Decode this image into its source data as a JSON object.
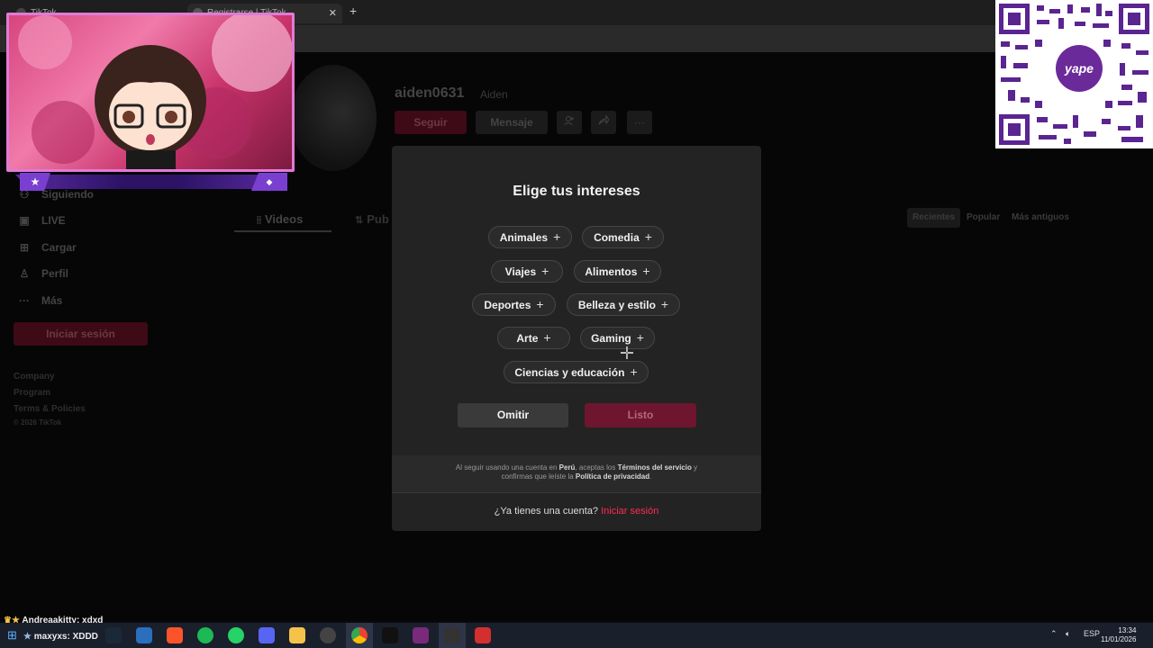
{
  "browser": {
    "tabs": [
      {
        "label": "TikTok"
      },
      {
        "label": "Registrarse | TikTok"
      }
    ],
    "new_tab": "+",
    "tab_close": "✕"
  },
  "profile": {
    "username": "aiden0631",
    "display_name": "Aiden",
    "follow_label": "Seguir",
    "message_label": "Mensaje",
    "more_label": "···"
  },
  "sidebar": {
    "items": [
      {
        "label": "Siguiendo",
        "icon": "following-icon"
      },
      {
        "label": "LIVE",
        "icon": "live-icon"
      },
      {
        "label": "Cargar",
        "icon": "upload-icon"
      },
      {
        "label": "Perfil",
        "icon": "profile-icon"
      },
      {
        "label": "Más",
        "icon": "more-icon"
      }
    ],
    "login_label": "Iniciar sesión",
    "footer": [
      "Company",
      "Program",
      "Terms & Policies",
      "© 2026 TikTok"
    ]
  },
  "content_tabs": {
    "videos": "Videos",
    "reposts": "Pub"
  },
  "sort": [
    "Recientes",
    "Popular",
    "Más antiguos"
  ],
  "modal": {
    "title": "Elige tus intereses",
    "interests": [
      "Animales",
      "Comedia",
      "Viajes",
      "Alimentos",
      "Deportes",
      "Belleza y estilo",
      "Arte",
      "Gaming",
      "Ciencias y educación"
    ],
    "plus": "+",
    "skip_label": "Omitir",
    "done_label": "Listo",
    "legal": {
      "p1": "Al seguir usando una cuenta en ",
      "country": "Perú",
      "p2": ", aceptas los ",
      "terms": "Términos del servicio",
      "p3": " y confirmas que leíste la ",
      "privacy": "Política de privacidad",
      "p4": "."
    },
    "have_account": "¿Ya tienes una cuenta?",
    "login_link": "Iniciar sesión"
  },
  "overlay": {
    "qr_label": "yape",
    "chat": [
      {
        "user": "Andreaakitty",
        "text": "xdxd"
      },
      {
        "user": "maxyxs",
        "text": "XDDD"
      }
    ]
  },
  "taskbar": {
    "lang": "ESP",
    "time": "13:34",
    "date": "11/01/2026"
  },
  "colors": {
    "accent": "#fe2c55",
    "primary_disabled": "#6e1530",
    "modal_bg": "#232323"
  }
}
